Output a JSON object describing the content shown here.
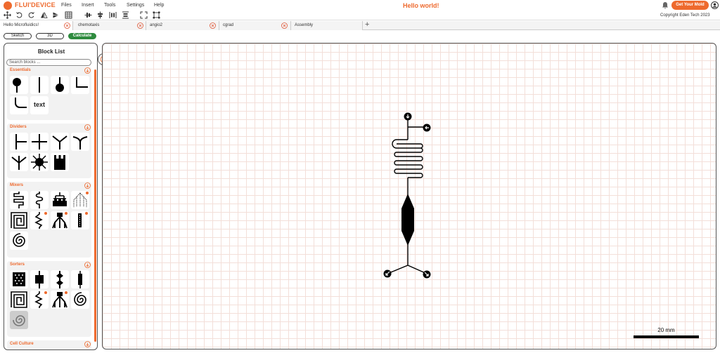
{
  "app": {
    "name": "FLUI'DEVICE",
    "document_title": "Hello world!",
    "copyright": "Copyright Eden Tech 2023",
    "brand_color": "#ee6a2e"
  },
  "menu": [
    "Files",
    "Insert",
    "Tools",
    "Settings",
    "Help"
  ],
  "header": {
    "get_mold_label": "Get Your Mold"
  },
  "toolbar_icons": [
    "move-icon",
    "undo-icon",
    "redo-icon",
    "mirror-icon",
    "flip-icon",
    "grid-icon",
    "align-horizontal-icon",
    "align-vertical-icon",
    "distribute-horizontal-icon",
    "distribute-vertical-icon",
    "fit-view-icon",
    "select-area-icon"
  ],
  "tabs": [
    {
      "label": "Hello Microfluidics!",
      "active": true
    },
    {
      "label": "chemotaxis",
      "active": false
    },
    {
      "label": "angio2",
      "active": false
    },
    {
      "label": "cgrad",
      "active": false
    },
    {
      "label": "Assembly",
      "active": false
    }
  ],
  "view_buttons": {
    "sketch": "Sketch",
    "three_d": "3D",
    "calculate": "Calculate"
  },
  "block_panel": {
    "title": "Block List",
    "search_placeholder": "Search blocks ...",
    "sections": [
      {
        "name": "Essentials",
        "blocks": [
          "inlet",
          "channel",
          "outlet",
          "corner",
          "bend",
          "text"
        ],
        "text_block_label": "text"
      },
      {
        "name": "Dividers",
        "blocks": [
          "t-junction",
          "cross-junction",
          "y-splitter",
          "y-splitter-curved",
          "tri-splitter",
          "star-splitter",
          "comb-splitter"
        ]
      },
      {
        "name": "Mixers",
        "blocks": [
          "serpentine-mixer",
          "wavy-mixer",
          "tree-mixer",
          "gradient-mixer",
          "square-spiral-mixer",
          "zigzag-mixer",
          "tree-splitter",
          "column-mixer",
          "spiral-mixer"
        ]
      },
      {
        "name": "Sorters",
        "blocks": [
          "pillar-sorter",
          "chamber-sorter",
          "drop-sorter",
          "bar-sorter",
          "square-spiral-sorter",
          "zigzag-sorter",
          "tree-sorter",
          "spiral-sorter",
          "round-spiral-sorter"
        ]
      },
      {
        "name": "Cell Culture",
        "blocks": []
      }
    ]
  },
  "canvas": {
    "scale_label": "20 mm"
  }
}
